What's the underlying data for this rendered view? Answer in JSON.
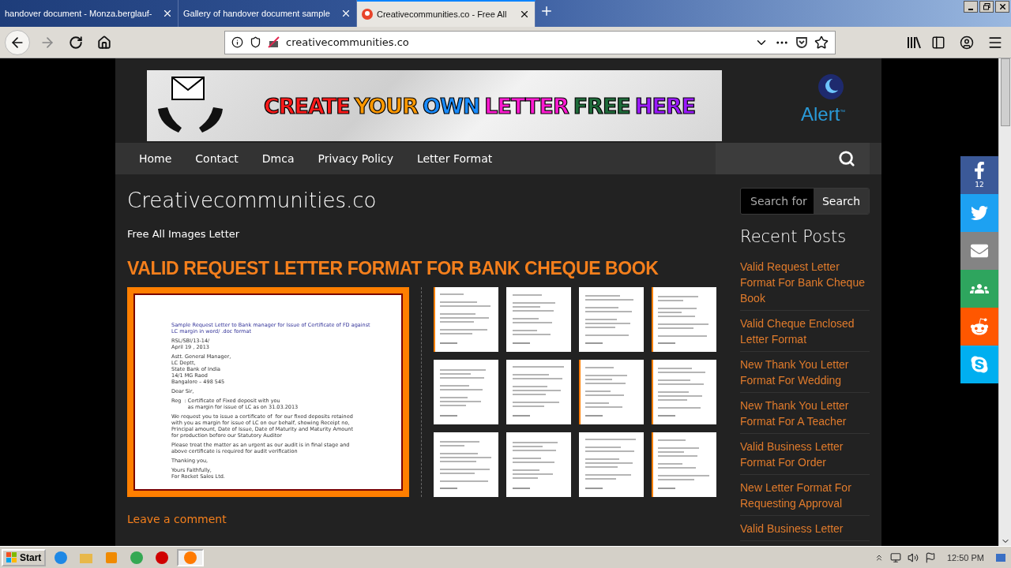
{
  "browser": {
    "tabs": [
      {
        "title": "handover document - Monza.berglauf-",
        "selected": false,
        "kind": "plain"
      },
      {
        "title": "Gallery of handover document sample",
        "selected": false,
        "kind": "plain"
      },
      {
        "title": "Creativecommunities.co - Free All",
        "selected": true,
        "kind": "site"
      }
    ],
    "url": "creativecommunities.co"
  },
  "banner": {
    "words": [
      {
        "text": "CREATE",
        "color": "#ff1a1a"
      },
      {
        "text": "YOUR",
        "color": "#ff9900"
      },
      {
        "text": "OWN",
        "color": "#1a8cff"
      },
      {
        "text": "LETTER",
        "color": "#ff1ad1"
      },
      {
        "text": "FREE",
        "color": "#1f6b3a"
      },
      {
        "text": "HERE",
        "color": "#9b1aff"
      }
    ]
  },
  "logo": {
    "text": "Alert",
    "mark": "™"
  },
  "nav": {
    "items": [
      "Home",
      "Contact",
      "Dmca",
      "Privacy Policy",
      "Letter Format"
    ]
  },
  "site_title": "Creativecommunities.co",
  "tagline": "Free All Images Letter",
  "post_title": "VALID REQUEST LETTER FORMAT FOR BANK CHEQUE BOOK",
  "letter": {
    "blocks": [
      {
        "kind": "heading",
        "lines": [
          "Sample Request Letter to Bank manager for Issue of Certificate of FD against",
          "LC margin in word/ .doc format"
        ]
      },
      {
        "kind": "text",
        "lines": [
          "RSL/SBI/13-14/",
          "April 19 , 2013"
        ]
      },
      {
        "kind": "text",
        "lines": [
          "Astt. General Manager,",
          "LC Deptt,",
          "State Bank of India",
          "14/1 MG Raod",
          "Bangalore – 498 545"
        ]
      },
      {
        "kind": "text",
        "lines": [
          "Dear Sir,"
        ]
      },
      {
        "kind": "text",
        "lines": [
          "Reg  : Certificate of Fixed deposit with you",
          "          as margin for issue of LC as on 31.03.2013"
        ]
      },
      {
        "kind": "text",
        "lines": [
          "We request you to issue a certificate of  for our fixed deposits retained",
          "with you as margin for issue of LC on our behalf, showing Receipt no,",
          "Principal amount, Date of Issue, Date of Maturity and Maturity Amount",
          "for production before our Statutory Auditor"
        ]
      },
      {
        "kind": "text",
        "lines": [
          "Please treat the matter as an urgent as our audit is in final stage and",
          "above certificate is required for audit verification"
        ]
      },
      {
        "kind": "text",
        "lines": [
          "Thanking you,"
        ]
      },
      {
        "kind": "text",
        "lines": [
          "Yours Faithfully,",
          "For Rocket Sales Ltd."
        ]
      }
    ]
  },
  "gallery": [
    {
      "kind": "thumbnail",
      "framed": true
    },
    {
      "kind": "thumbnail",
      "framed": false
    },
    {
      "kind": "thumbnail",
      "framed": false
    },
    {
      "kind": "thumbnail",
      "framed": true
    },
    {
      "kind": "thumbnail",
      "framed": false
    },
    {
      "kind": "thumbnail",
      "framed": false
    },
    {
      "kind": "thumbnail",
      "framed": true
    },
    {
      "kind": "thumbnail",
      "framed": true
    },
    {
      "kind": "thumbnail",
      "framed": false
    },
    {
      "kind": "thumbnail",
      "framed": false
    },
    {
      "kind": "thumbnail",
      "framed": false
    },
    {
      "kind": "thumbnail",
      "framed": true
    }
  ],
  "comment_link": "Leave a comment",
  "sidebar": {
    "search_placeholder": "Search for",
    "search_button": "Search",
    "heading": "Recent Posts",
    "posts": [
      "Valid Request Letter Format For Bank Cheque Book",
      "Valid Cheque Enclosed Letter Format",
      "New Thank You Letter Format For Wedding",
      "New Thank You Letter Format For A Teacher",
      "Valid Business Letter Format For Order",
      "New Letter Format For Requesting Approval",
      "Valid Business Letter"
    ]
  },
  "share": [
    {
      "kind": "facebook",
      "count": "12",
      "color": "#3b5998"
    },
    {
      "kind": "twitter",
      "color": "#1da1f2"
    },
    {
      "kind": "email",
      "color": "#848484"
    },
    {
      "kind": "group",
      "color": "#2ea55e"
    },
    {
      "kind": "reddit",
      "color": "#ff5700"
    },
    {
      "kind": "skype",
      "color": "#00aff0"
    }
  ],
  "taskbar": {
    "start": "Start",
    "apps": [
      {
        "kind": "ie",
        "selected": false
      },
      {
        "kind": "folder",
        "selected": false
      },
      {
        "kind": "media",
        "selected": false
      },
      {
        "kind": "chrome",
        "selected": false
      },
      {
        "kind": "opera",
        "selected": false
      },
      {
        "kind": "firefox",
        "selected": true
      }
    ],
    "clock": "12:50 PM"
  }
}
